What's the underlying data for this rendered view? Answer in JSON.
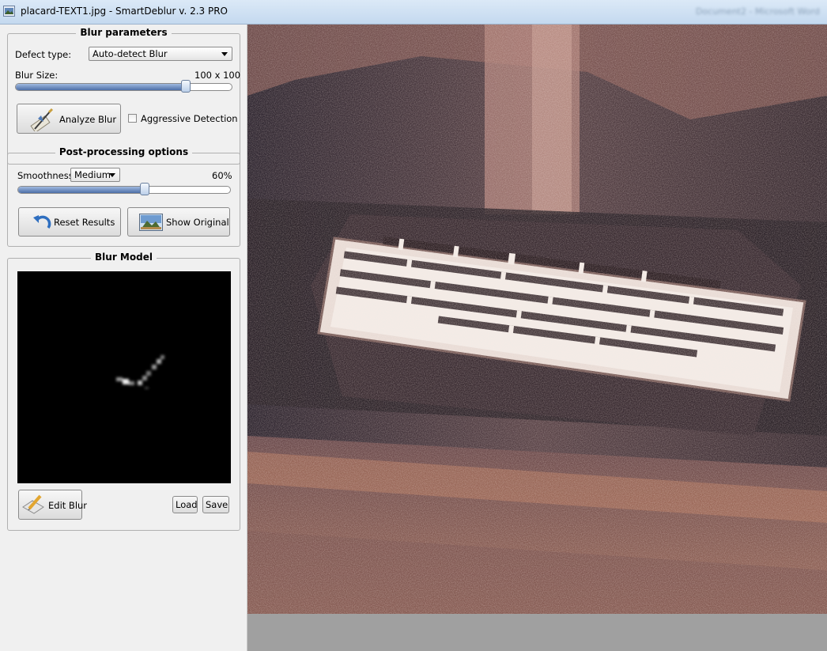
{
  "window": {
    "title": "placard-TEXT1.jpg - SmartDeblur v. 2.3 PRO",
    "background_text": "Document2 - Microsoft Word"
  },
  "blur_parameters": {
    "heading": "Blur parameters",
    "defect_type_label": "Defect type:",
    "defect_type_value": "Auto-detect Blur",
    "blur_size_label": "Blur Size:",
    "blur_size_value": "100 x 100",
    "blur_size_fraction": 0.8,
    "analyze_button": "Analyze Blur",
    "aggressive_label": "Aggressive Detection",
    "aggressive_checked": false
  },
  "post_processing": {
    "heading": "Post-processing options",
    "smoothness_label": "Smoothness:",
    "smoothness_value": "Medium",
    "smoothness_percent": "60%",
    "smoothness_fraction": 0.6,
    "reset_button": "Reset Results",
    "show_original_button": "Show Original"
  },
  "blur_model": {
    "heading": "Blur Model",
    "edit_button": "Edit Blur",
    "load_button": "Load",
    "save_button": "Save"
  },
  "colors": {
    "accent": "#4d6fa8",
    "title_bar": "#c4d9ef",
    "canvas_bg": "#a0a0a0"
  }
}
